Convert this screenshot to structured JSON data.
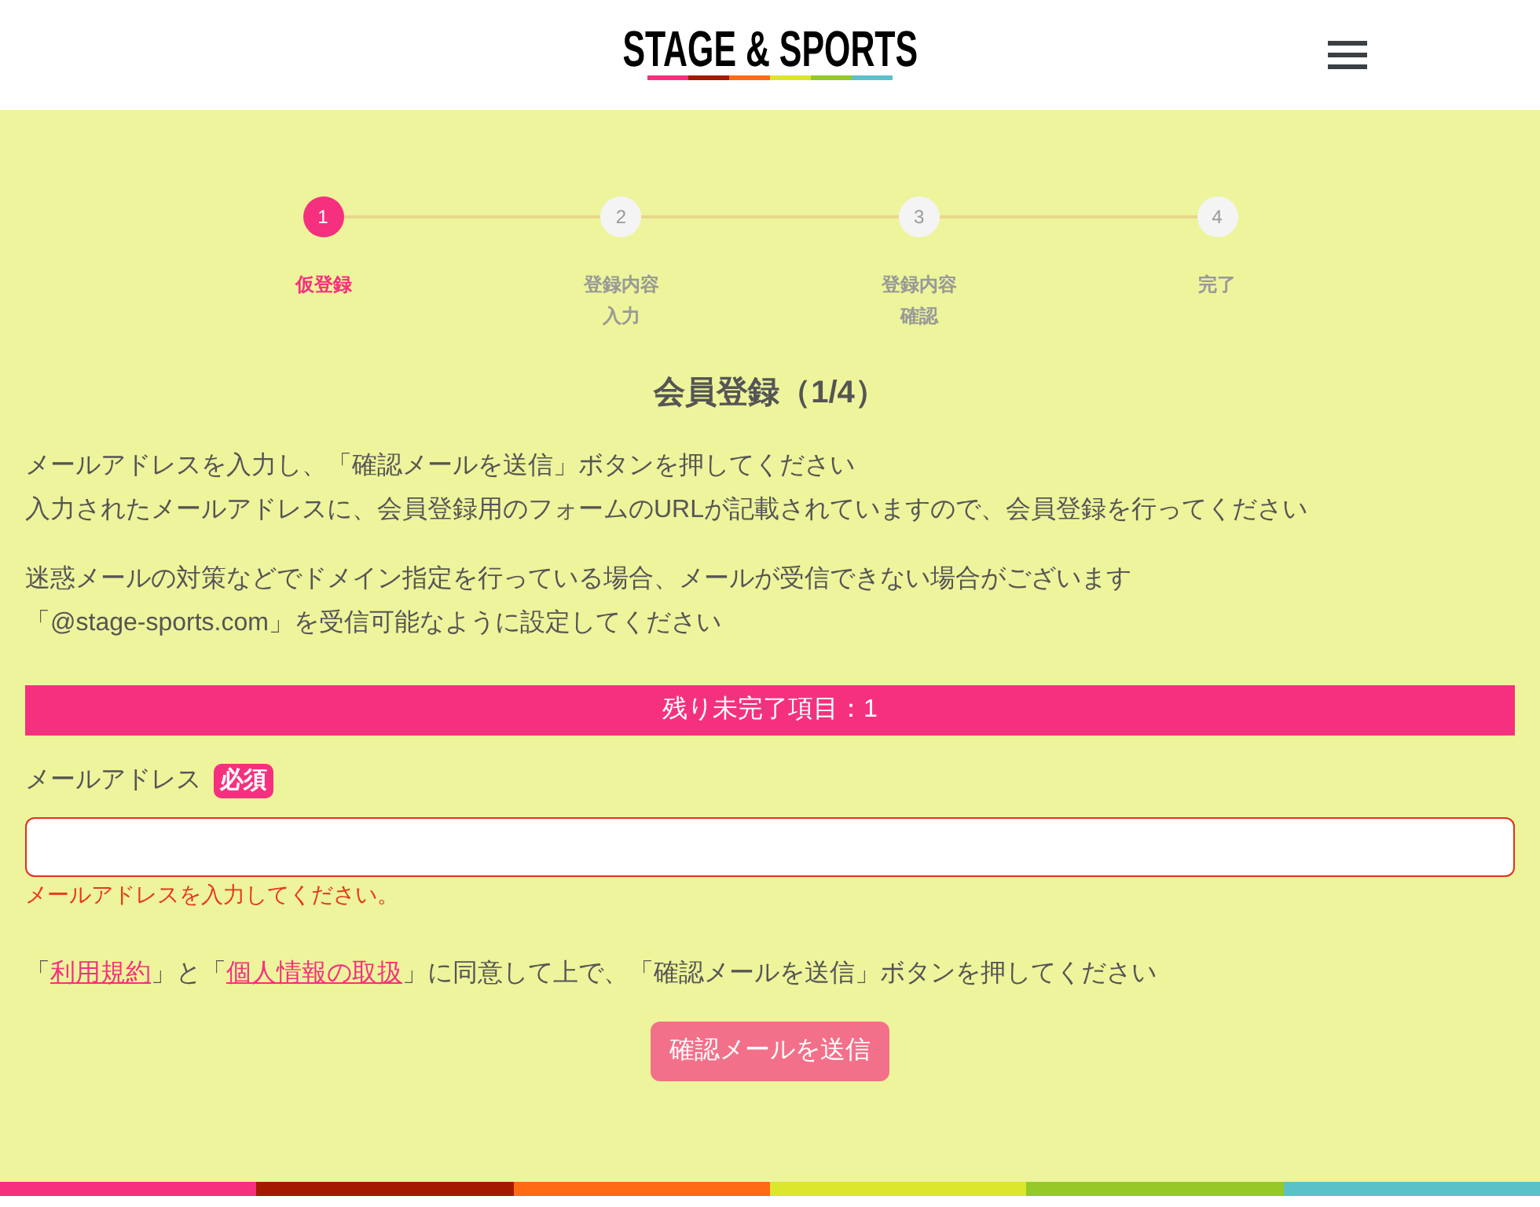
{
  "header": {
    "logo": "STAGE & SPORTS"
  },
  "steps": [
    {
      "number": "1",
      "label": "仮登録",
      "selected": true
    },
    {
      "number": "2",
      "label": "登録内容入力",
      "selected": false
    },
    {
      "number": "3",
      "label": "登録内容確認",
      "selected": false
    },
    {
      "number": "4",
      "label": "完了",
      "selected": false
    }
  ],
  "title": "会員登録（1/4）",
  "intro": [
    "メールアドレスを入力し、「確認メールを送信」ボタンを押してください",
    "入力されたメールアドレスに、会員登録用のフォームのURLが記載されていますので、会員登録を行ってください"
  ],
  "notice": [
    "迷惑メールの対策などでドメイン指定を行っている場合、メールが受信できない場合がございます",
    "「@stage-sports.com」を受信可能なように設定してください"
  ],
  "remaining_banner": "残り未完了項目：1",
  "email_field": {
    "label": "メールアドレス",
    "badge": "必須",
    "invalid": true,
    "error": "メールアドレスを入力してください。"
  },
  "agreement": [
    {
      "kind": "text",
      "text": "「"
    },
    {
      "kind": "link",
      "text": "利用規約"
    },
    {
      "kind": "text",
      "text": "」と「"
    },
    {
      "kind": "link",
      "text": "個人情報の取扱"
    },
    {
      "kind": "text",
      "text": "」に同意して上で、「確認メールを送信」ボタンを押してください"
    }
  ],
  "submit_button": {
    "label": "確認メールを送信",
    "disabled": true
  }
}
